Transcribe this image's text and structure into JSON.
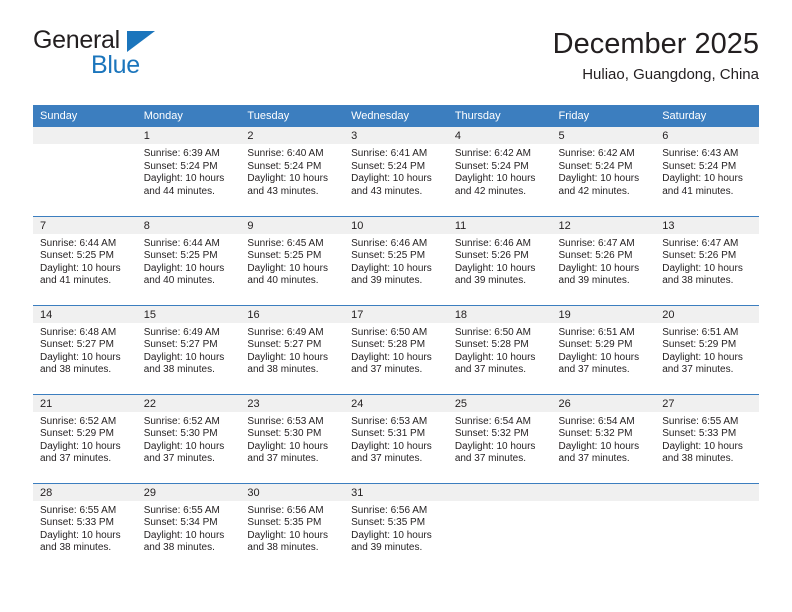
{
  "brand": {
    "name_top": "General",
    "name_bottom": "Blue"
  },
  "header": {
    "title": "December 2025",
    "subtitle": "Huliao, Guangdong, China"
  },
  "colors": {
    "header_blue": "#3C7EBF",
    "logo_blue": "#1B75BC",
    "daynum_band": "#F0F0F0",
    "text": "#231F20"
  },
  "weekday_headers": [
    "Sunday",
    "Monday",
    "Tuesday",
    "Wednesday",
    "Thursday",
    "Friday",
    "Saturday"
  ],
  "weeks": [
    [
      {
        "day": "",
        "sunrise": "",
        "sunset": "",
        "daylight_line1": "",
        "daylight_line2": ""
      },
      {
        "day": "1",
        "sunrise": "Sunrise: 6:39 AM",
        "sunset": "Sunset: 5:24 PM",
        "daylight_line1": "Daylight: 10 hours",
        "daylight_line2": "and 44 minutes."
      },
      {
        "day": "2",
        "sunrise": "Sunrise: 6:40 AM",
        "sunset": "Sunset: 5:24 PM",
        "daylight_line1": "Daylight: 10 hours",
        "daylight_line2": "and 43 minutes."
      },
      {
        "day": "3",
        "sunrise": "Sunrise: 6:41 AM",
        "sunset": "Sunset: 5:24 PM",
        "daylight_line1": "Daylight: 10 hours",
        "daylight_line2": "and 43 minutes."
      },
      {
        "day": "4",
        "sunrise": "Sunrise: 6:42 AM",
        "sunset": "Sunset: 5:24 PM",
        "daylight_line1": "Daylight: 10 hours",
        "daylight_line2": "and 42 minutes."
      },
      {
        "day": "5",
        "sunrise": "Sunrise: 6:42 AM",
        "sunset": "Sunset: 5:24 PM",
        "daylight_line1": "Daylight: 10 hours",
        "daylight_line2": "and 42 minutes."
      },
      {
        "day": "6",
        "sunrise": "Sunrise: 6:43 AM",
        "sunset": "Sunset: 5:24 PM",
        "daylight_line1": "Daylight: 10 hours",
        "daylight_line2": "and 41 minutes."
      }
    ],
    [
      {
        "day": "7",
        "sunrise": "Sunrise: 6:44 AM",
        "sunset": "Sunset: 5:25 PM",
        "daylight_line1": "Daylight: 10 hours",
        "daylight_line2": "and 41 minutes."
      },
      {
        "day": "8",
        "sunrise": "Sunrise: 6:44 AM",
        "sunset": "Sunset: 5:25 PM",
        "daylight_line1": "Daylight: 10 hours",
        "daylight_line2": "and 40 minutes."
      },
      {
        "day": "9",
        "sunrise": "Sunrise: 6:45 AM",
        "sunset": "Sunset: 5:25 PM",
        "daylight_line1": "Daylight: 10 hours",
        "daylight_line2": "and 40 minutes."
      },
      {
        "day": "10",
        "sunrise": "Sunrise: 6:46 AM",
        "sunset": "Sunset: 5:25 PM",
        "daylight_line1": "Daylight: 10 hours",
        "daylight_line2": "and 39 minutes."
      },
      {
        "day": "11",
        "sunrise": "Sunrise: 6:46 AM",
        "sunset": "Sunset: 5:26 PM",
        "daylight_line1": "Daylight: 10 hours",
        "daylight_line2": "and 39 minutes."
      },
      {
        "day": "12",
        "sunrise": "Sunrise: 6:47 AM",
        "sunset": "Sunset: 5:26 PM",
        "daylight_line1": "Daylight: 10 hours",
        "daylight_line2": "and 39 minutes."
      },
      {
        "day": "13",
        "sunrise": "Sunrise: 6:47 AM",
        "sunset": "Sunset: 5:26 PM",
        "daylight_line1": "Daylight: 10 hours",
        "daylight_line2": "and 38 minutes."
      }
    ],
    [
      {
        "day": "14",
        "sunrise": "Sunrise: 6:48 AM",
        "sunset": "Sunset: 5:27 PM",
        "daylight_line1": "Daylight: 10 hours",
        "daylight_line2": "and 38 minutes."
      },
      {
        "day": "15",
        "sunrise": "Sunrise: 6:49 AM",
        "sunset": "Sunset: 5:27 PM",
        "daylight_line1": "Daylight: 10 hours",
        "daylight_line2": "and 38 minutes."
      },
      {
        "day": "16",
        "sunrise": "Sunrise: 6:49 AM",
        "sunset": "Sunset: 5:27 PM",
        "daylight_line1": "Daylight: 10 hours",
        "daylight_line2": "and 38 minutes."
      },
      {
        "day": "17",
        "sunrise": "Sunrise: 6:50 AM",
        "sunset": "Sunset: 5:28 PM",
        "daylight_line1": "Daylight: 10 hours",
        "daylight_line2": "and 37 minutes."
      },
      {
        "day": "18",
        "sunrise": "Sunrise: 6:50 AM",
        "sunset": "Sunset: 5:28 PM",
        "daylight_line1": "Daylight: 10 hours",
        "daylight_line2": "and 37 minutes."
      },
      {
        "day": "19",
        "sunrise": "Sunrise: 6:51 AM",
        "sunset": "Sunset: 5:29 PM",
        "daylight_line1": "Daylight: 10 hours",
        "daylight_line2": "and 37 minutes."
      },
      {
        "day": "20",
        "sunrise": "Sunrise: 6:51 AM",
        "sunset": "Sunset: 5:29 PM",
        "daylight_line1": "Daylight: 10 hours",
        "daylight_line2": "and 37 minutes."
      }
    ],
    [
      {
        "day": "21",
        "sunrise": "Sunrise: 6:52 AM",
        "sunset": "Sunset: 5:29 PM",
        "daylight_line1": "Daylight: 10 hours",
        "daylight_line2": "and 37 minutes."
      },
      {
        "day": "22",
        "sunrise": "Sunrise: 6:52 AM",
        "sunset": "Sunset: 5:30 PM",
        "daylight_line1": "Daylight: 10 hours",
        "daylight_line2": "and 37 minutes."
      },
      {
        "day": "23",
        "sunrise": "Sunrise: 6:53 AM",
        "sunset": "Sunset: 5:30 PM",
        "daylight_line1": "Daylight: 10 hours",
        "daylight_line2": "and 37 minutes."
      },
      {
        "day": "24",
        "sunrise": "Sunrise: 6:53 AM",
        "sunset": "Sunset: 5:31 PM",
        "daylight_line1": "Daylight: 10 hours",
        "daylight_line2": "and 37 minutes."
      },
      {
        "day": "25",
        "sunrise": "Sunrise: 6:54 AM",
        "sunset": "Sunset: 5:32 PM",
        "daylight_line1": "Daylight: 10 hours",
        "daylight_line2": "and 37 minutes."
      },
      {
        "day": "26",
        "sunrise": "Sunrise: 6:54 AM",
        "sunset": "Sunset: 5:32 PM",
        "daylight_line1": "Daylight: 10 hours",
        "daylight_line2": "and 37 minutes."
      },
      {
        "day": "27",
        "sunrise": "Sunrise: 6:55 AM",
        "sunset": "Sunset: 5:33 PM",
        "daylight_line1": "Daylight: 10 hours",
        "daylight_line2": "and 38 minutes."
      }
    ],
    [
      {
        "day": "28",
        "sunrise": "Sunrise: 6:55 AM",
        "sunset": "Sunset: 5:33 PM",
        "daylight_line1": "Daylight: 10 hours",
        "daylight_line2": "and 38 minutes."
      },
      {
        "day": "29",
        "sunrise": "Sunrise: 6:55 AM",
        "sunset": "Sunset: 5:34 PM",
        "daylight_line1": "Daylight: 10 hours",
        "daylight_line2": "and 38 minutes."
      },
      {
        "day": "30",
        "sunrise": "Sunrise: 6:56 AM",
        "sunset": "Sunset: 5:35 PM",
        "daylight_line1": "Daylight: 10 hours",
        "daylight_line2": "and 38 minutes."
      },
      {
        "day": "31",
        "sunrise": "Sunrise: 6:56 AM",
        "sunset": "Sunset: 5:35 PM",
        "daylight_line1": "Daylight: 10 hours",
        "daylight_line2": "and 39 minutes."
      },
      {
        "day": "",
        "sunrise": "",
        "sunset": "",
        "daylight_line1": "",
        "daylight_line2": ""
      },
      {
        "day": "",
        "sunrise": "",
        "sunset": "",
        "daylight_line1": "",
        "daylight_line2": ""
      },
      {
        "day": "",
        "sunrise": "",
        "sunset": "",
        "daylight_line1": "",
        "daylight_line2": ""
      }
    ]
  ]
}
